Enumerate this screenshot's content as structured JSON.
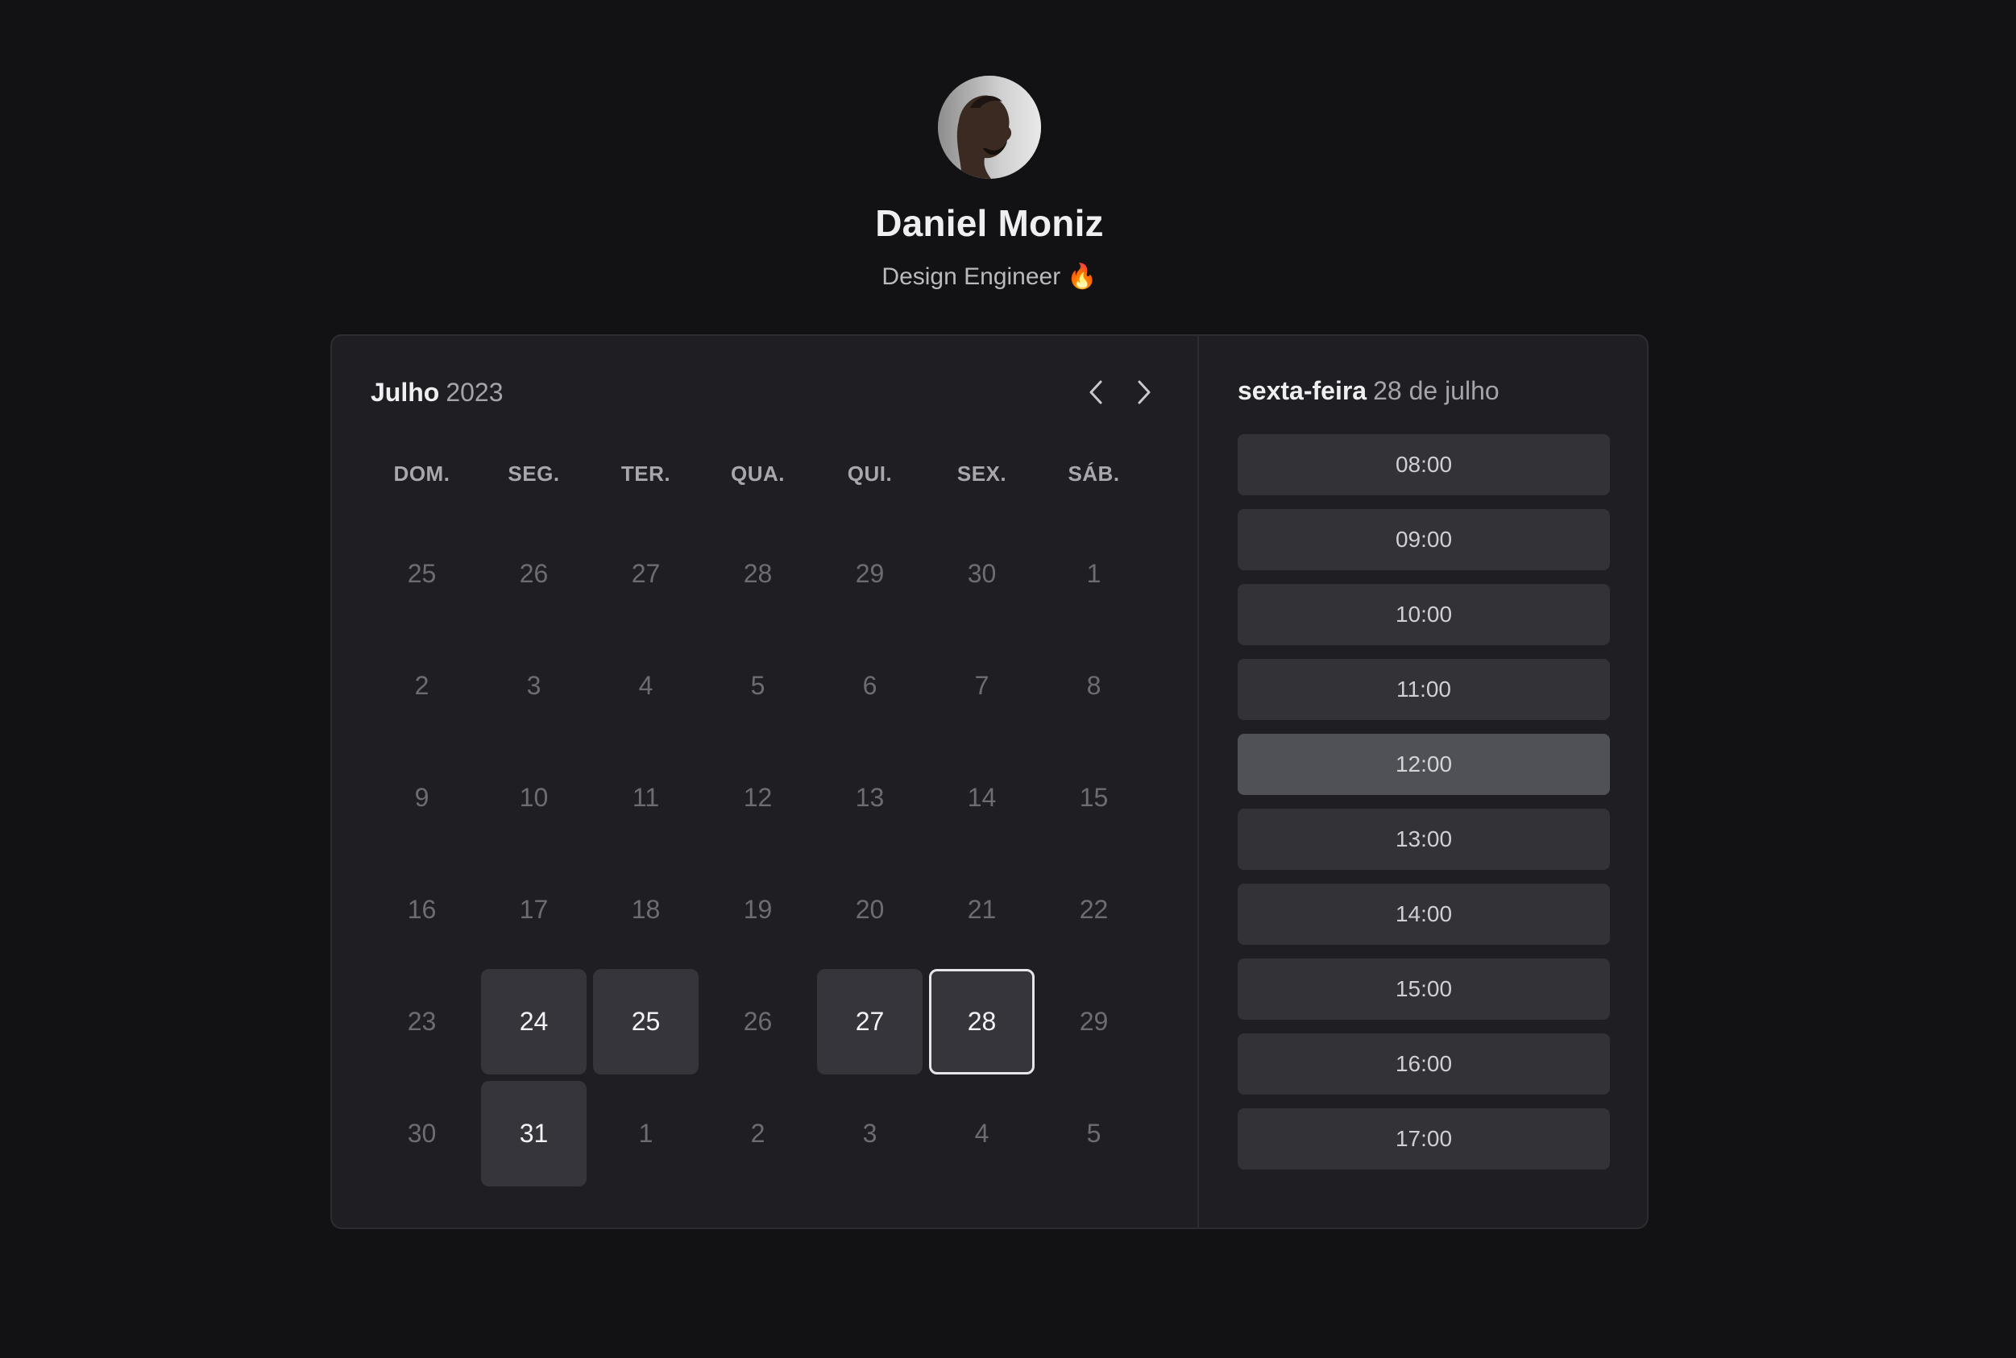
{
  "profile": {
    "name": "Daniel Moniz",
    "role": "Design Engineer",
    "role_emoji": "🔥"
  },
  "calendar": {
    "month": "Julho",
    "year": "2023",
    "prev_label": "‹",
    "next_label": "›",
    "weekdays": [
      "DOM.",
      "SEG.",
      "TER.",
      "QUA.",
      "QUI.",
      "SEX.",
      "SÁB."
    ],
    "weeks": [
      [
        "25",
        "26",
        "27",
        "28",
        "29",
        "30",
        "1"
      ],
      [
        "2",
        "3",
        "4",
        "5",
        "6",
        "7",
        "8"
      ],
      [
        "9",
        "10",
        "11",
        "12",
        "13",
        "14",
        "15"
      ],
      [
        "16",
        "17",
        "18",
        "19",
        "20",
        "21",
        "22"
      ],
      [
        "23",
        "24",
        "25",
        "26",
        "27",
        "28",
        "29"
      ],
      [
        "30",
        "31",
        "1",
        "2",
        "3",
        "4",
        "5"
      ]
    ],
    "available_days": [
      "24",
      "25",
      "27",
      "28",
      "31"
    ],
    "selected_day": "28"
  },
  "schedule": {
    "weekday": "sexta-feira",
    "date": "28 de julho",
    "slots": [
      "08:00",
      "09:00",
      "10:00",
      "11:00",
      "12:00",
      "13:00",
      "14:00",
      "15:00",
      "16:00",
      "17:00"
    ],
    "active_slot": "12:00"
  },
  "colors": {
    "background": "#121215",
    "card": "#1f1f23",
    "available_day": "#35353b",
    "slot": "#323237",
    "slot_active": "#505057"
  }
}
